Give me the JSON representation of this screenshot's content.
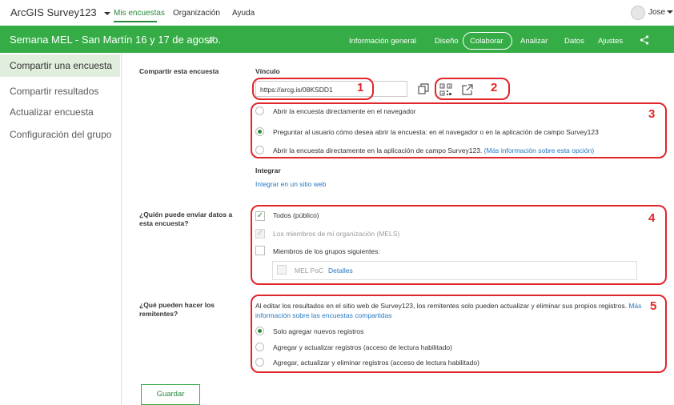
{
  "topbar": {
    "app_name": "ArcGIS Survey123",
    "nav": [
      "Mis encuestas",
      "Organización",
      "Ayuda"
    ],
    "user": "Jose"
  },
  "survey": {
    "title": "Semana MEL - San Martín 16 y 17 de agosto.",
    "tabs": [
      "Información general",
      "Diseño",
      "Colaborar",
      "Analizar",
      "Datos",
      "Ajustes"
    ]
  },
  "sidebar": {
    "items": [
      "Compartir una encuesta",
      "Compartir resultados",
      "Actualizar encuesta",
      "Configuración del grupo"
    ]
  },
  "share": {
    "heading": "Compartir esta encuesta",
    "link_label": "Vínculo",
    "link_value": "https://arcg.is/08KSDD1",
    "radio_options": [
      "Abrir la encuesta directamente en el navegador",
      "Preguntar al usuario cómo desea abrir la encuesta: en el navegador o en la aplicación de campo Survey123",
      "Abrir la encuesta directamente en la aplicación de campo Survey123."
    ],
    "radio_more_link": "(Más información sobre esta opción)",
    "embed_label": "Integrar",
    "embed_link": "Integrar en un sitio web"
  },
  "who": {
    "question": "¿Quién puede enviar datos a esta encuesta?",
    "options": [
      "Todos (público)",
      "Los miembros de mi organización (MELS)",
      "Miembros de los grupos siguientes:"
    ],
    "group_name": "MEL PoC",
    "group_details": "Detalles"
  },
  "what": {
    "question": "¿Qué pueden hacer los remitentes?",
    "intro": "Al editar los resultados en el sitio web de Survey123, los remitentes solo pueden actualizar y eliminar sus propios registros.",
    "intro_link": "Más información sobre las encuestas compartidas",
    "options": [
      "Solo agregar nuevos registros",
      "Agregar y actualizar registros (acceso de lectura habilitado)",
      "Agregar, actualizar y eliminar registros (acceso de lectura habilitado)"
    ]
  },
  "save_label": "Guardar",
  "annotations": [
    "1",
    "2",
    "3",
    "4",
    "5"
  ],
  "colors": {
    "brand_green": "#35ac46",
    "accent_green": "#2a8a3c",
    "link": "#2679c2",
    "annotation_red": "#e0262b"
  }
}
